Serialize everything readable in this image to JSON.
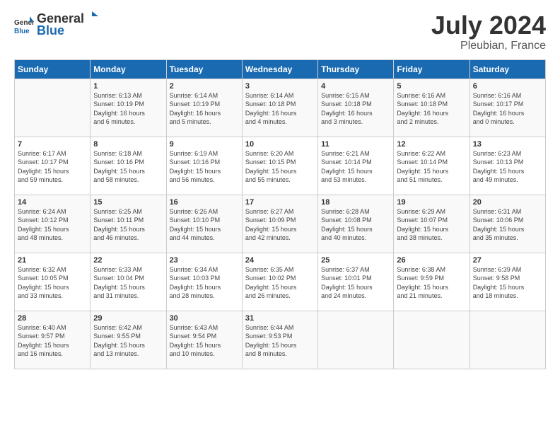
{
  "header": {
    "logo_general": "General",
    "logo_blue": "Blue",
    "title": "July 2024",
    "subtitle": "Pleubian, France"
  },
  "days_of_week": [
    "Sunday",
    "Monday",
    "Tuesday",
    "Wednesday",
    "Thursday",
    "Friday",
    "Saturday"
  ],
  "weeks": [
    [
      {
        "day": "",
        "info": ""
      },
      {
        "day": "1",
        "info": "Sunrise: 6:13 AM\nSunset: 10:19 PM\nDaylight: 16 hours\nand 6 minutes."
      },
      {
        "day": "2",
        "info": "Sunrise: 6:14 AM\nSunset: 10:19 PM\nDaylight: 16 hours\nand 5 minutes."
      },
      {
        "day": "3",
        "info": "Sunrise: 6:14 AM\nSunset: 10:18 PM\nDaylight: 16 hours\nand 4 minutes."
      },
      {
        "day": "4",
        "info": "Sunrise: 6:15 AM\nSunset: 10:18 PM\nDaylight: 16 hours\nand 3 minutes."
      },
      {
        "day": "5",
        "info": "Sunrise: 6:16 AM\nSunset: 10:18 PM\nDaylight: 16 hours\nand 2 minutes."
      },
      {
        "day": "6",
        "info": "Sunrise: 6:16 AM\nSunset: 10:17 PM\nDaylight: 16 hours\nand 0 minutes."
      }
    ],
    [
      {
        "day": "7",
        "info": "Sunrise: 6:17 AM\nSunset: 10:17 PM\nDaylight: 15 hours\nand 59 minutes."
      },
      {
        "day": "8",
        "info": "Sunrise: 6:18 AM\nSunset: 10:16 PM\nDaylight: 15 hours\nand 58 minutes."
      },
      {
        "day": "9",
        "info": "Sunrise: 6:19 AM\nSunset: 10:16 PM\nDaylight: 15 hours\nand 56 minutes."
      },
      {
        "day": "10",
        "info": "Sunrise: 6:20 AM\nSunset: 10:15 PM\nDaylight: 15 hours\nand 55 minutes."
      },
      {
        "day": "11",
        "info": "Sunrise: 6:21 AM\nSunset: 10:14 PM\nDaylight: 15 hours\nand 53 minutes."
      },
      {
        "day": "12",
        "info": "Sunrise: 6:22 AM\nSunset: 10:14 PM\nDaylight: 15 hours\nand 51 minutes."
      },
      {
        "day": "13",
        "info": "Sunrise: 6:23 AM\nSunset: 10:13 PM\nDaylight: 15 hours\nand 49 minutes."
      }
    ],
    [
      {
        "day": "14",
        "info": "Sunrise: 6:24 AM\nSunset: 10:12 PM\nDaylight: 15 hours\nand 48 minutes."
      },
      {
        "day": "15",
        "info": "Sunrise: 6:25 AM\nSunset: 10:11 PM\nDaylight: 15 hours\nand 46 minutes."
      },
      {
        "day": "16",
        "info": "Sunrise: 6:26 AM\nSunset: 10:10 PM\nDaylight: 15 hours\nand 44 minutes."
      },
      {
        "day": "17",
        "info": "Sunrise: 6:27 AM\nSunset: 10:09 PM\nDaylight: 15 hours\nand 42 minutes."
      },
      {
        "day": "18",
        "info": "Sunrise: 6:28 AM\nSunset: 10:08 PM\nDaylight: 15 hours\nand 40 minutes."
      },
      {
        "day": "19",
        "info": "Sunrise: 6:29 AM\nSunset: 10:07 PM\nDaylight: 15 hours\nand 38 minutes."
      },
      {
        "day": "20",
        "info": "Sunrise: 6:31 AM\nSunset: 10:06 PM\nDaylight: 15 hours\nand 35 minutes."
      }
    ],
    [
      {
        "day": "21",
        "info": "Sunrise: 6:32 AM\nSunset: 10:05 PM\nDaylight: 15 hours\nand 33 minutes."
      },
      {
        "day": "22",
        "info": "Sunrise: 6:33 AM\nSunset: 10:04 PM\nDaylight: 15 hours\nand 31 minutes."
      },
      {
        "day": "23",
        "info": "Sunrise: 6:34 AM\nSunset: 10:03 PM\nDaylight: 15 hours\nand 28 minutes."
      },
      {
        "day": "24",
        "info": "Sunrise: 6:35 AM\nSunset: 10:02 PM\nDaylight: 15 hours\nand 26 minutes."
      },
      {
        "day": "25",
        "info": "Sunrise: 6:37 AM\nSunset: 10:01 PM\nDaylight: 15 hours\nand 24 minutes."
      },
      {
        "day": "26",
        "info": "Sunrise: 6:38 AM\nSunset: 9:59 PM\nDaylight: 15 hours\nand 21 minutes."
      },
      {
        "day": "27",
        "info": "Sunrise: 6:39 AM\nSunset: 9:58 PM\nDaylight: 15 hours\nand 18 minutes."
      }
    ],
    [
      {
        "day": "28",
        "info": "Sunrise: 6:40 AM\nSunset: 9:57 PM\nDaylight: 15 hours\nand 16 minutes."
      },
      {
        "day": "29",
        "info": "Sunrise: 6:42 AM\nSunset: 9:55 PM\nDaylight: 15 hours\nand 13 minutes."
      },
      {
        "day": "30",
        "info": "Sunrise: 6:43 AM\nSunset: 9:54 PM\nDaylight: 15 hours\nand 10 minutes."
      },
      {
        "day": "31",
        "info": "Sunrise: 6:44 AM\nSunset: 9:53 PM\nDaylight: 15 hours\nand 8 minutes."
      },
      {
        "day": "",
        "info": ""
      },
      {
        "day": "",
        "info": ""
      },
      {
        "day": "",
        "info": ""
      }
    ]
  ]
}
